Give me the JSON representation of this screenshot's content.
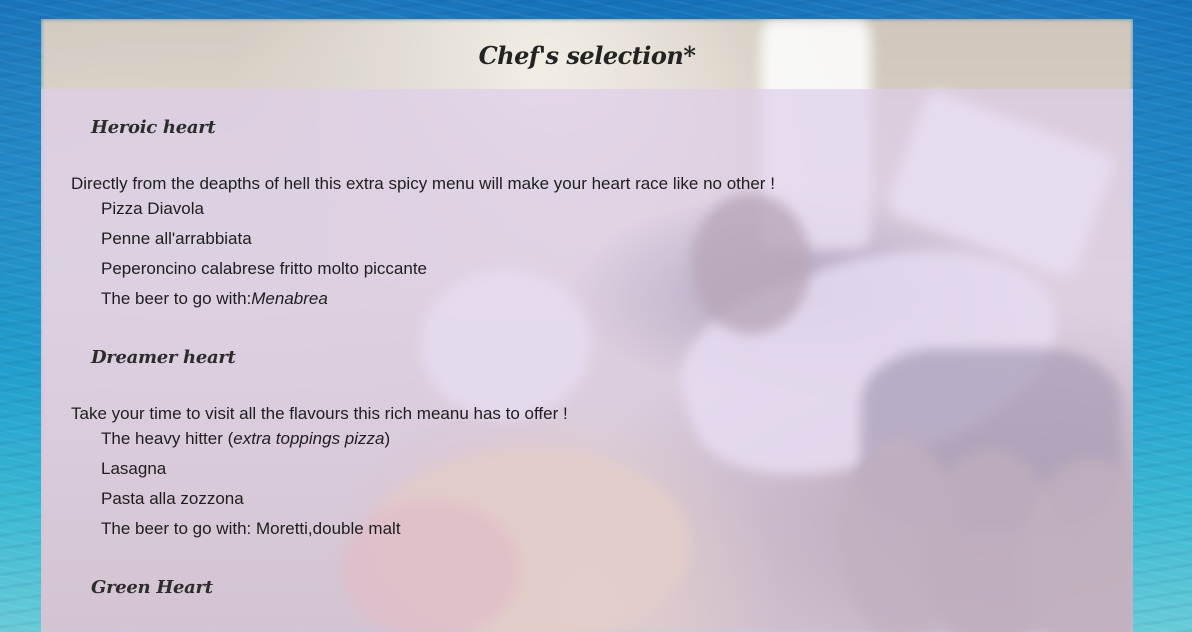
{
  "page": {
    "title": "Chef's selection*"
  },
  "sections": [
    {
      "title": "Heroic heart",
      "description": "Directly from the deapths of hell this extra spicy menu will make your heart race like no other !",
      "items": [
        {
          "text": "Pizza Diavola"
        },
        {
          "text": "Penne all'arrabbiata"
        },
        {
          "text": "Peperoncino calabrese fritto molto piccante"
        },
        {
          "prefix": "The beer to go with:",
          "emphasis": "Menabrea"
        }
      ]
    },
    {
      "title": "Dreamer heart",
      "description": "Take your time to visit all the flavours this rich meanu has to offer !",
      "items": [
        {
          "prefix": "The heavy hitter (",
          "emphasis": "extra toppings pizza",
          "suffix": ")"
        },
        {
          "text": "Lasagna"
        },
        {
          "text": "Pasta alla zozzona"
        },
        {
          "text": "The beer to go with: Moretti,double malt"
        }
      ]
    },
    {
      "title": "Green Heart"
    }
  ],
  "colors": {
    "ocean_top": "#0f6fb8",
    "ocean_bottom": "#68cbd8",
    "overlay": "#ded0ec",
    "text": "#1e1e1e"
  }
}
